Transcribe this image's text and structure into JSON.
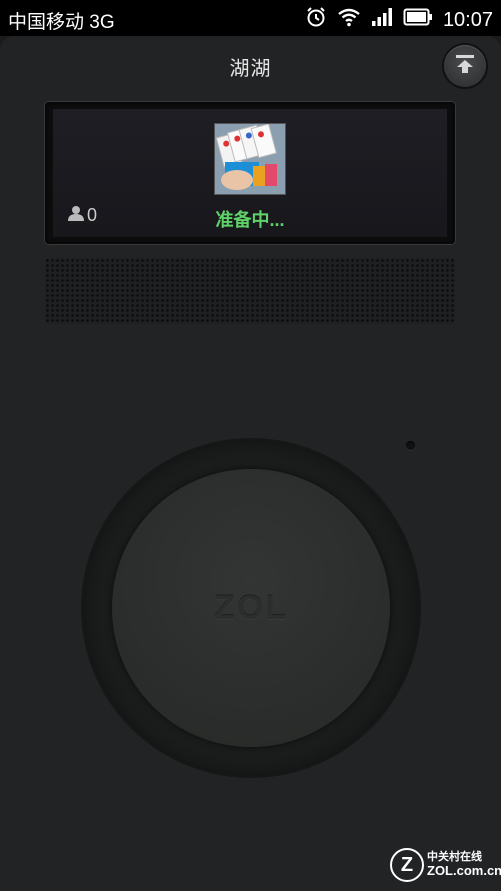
{
  "status_bar": {
    "carrier": "中国移动 3G",
    "time": "10:07",
    "icons": [
      "alarm-icon",
      "wifi-icon",
      "signal-icon",
      "battery-icon"
    ]
  },
  "header": {
    "title": "湖湖",
    "eject_icon": "eject-icon"
  },
  "screen": {
    "listener_count": "0",
    "listener_icon": "person-icon",
    "status": "准备中...",
    "status_color": "#5fd36a"
  },
  "knob": {
    "label": "ZOL"
  },
  "watermark": {
    "logo": "Z",
    "cn": "中关村在线",
    "en": "ZOL.com.cn"
  }
}
